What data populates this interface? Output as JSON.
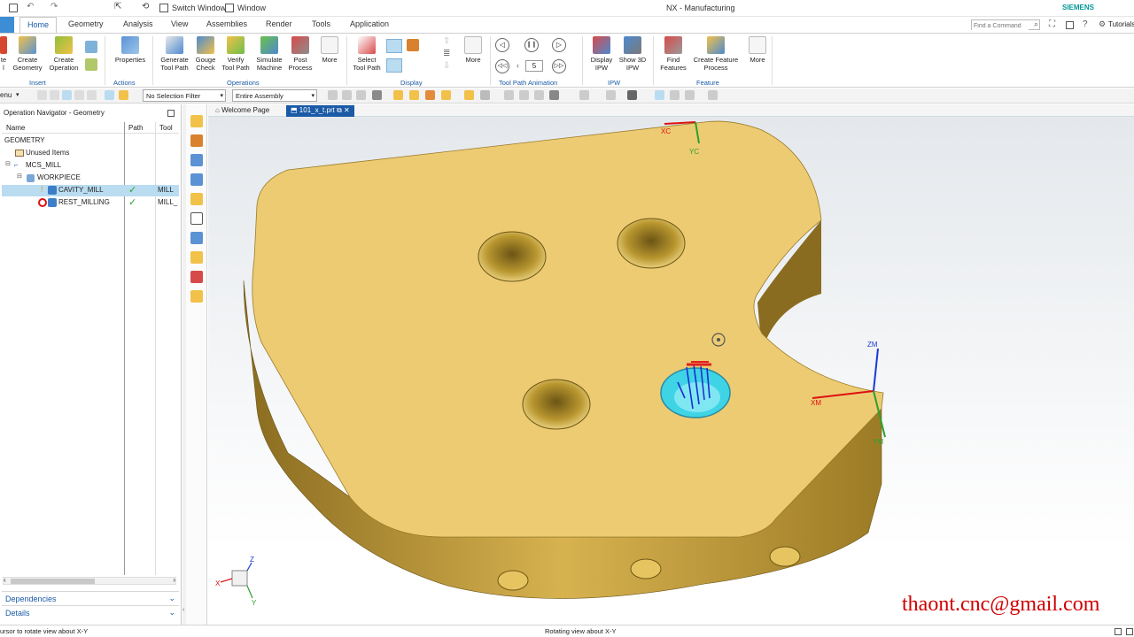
{
  "titlebar": {
    "switch_window": "Switch Window",
    "window": "Window",
    "app_title": "NX - Manufacturing",
    "brand": "SIEMENS",
    "find_command_placeholder": "Find a Command",
    "tutorials": "Tutorials"
  },
  "tabs": [
    "Home",
    "Geometry",
    "Analysis",
    "View",
    "Assemblies",
    "Render",
    "Tools",
    "Application"
  ],
  "ribbon": {
    "insert": {
      "label": "Insert",
      "create_geometry": "Create Geometry",
      "create_operation": "Create Operation",
      "create_program": "te\nl"
    },
    "actions": {
      "label": "Actions",
      "properties": "Properties"
    },
    "operations": {
      "label": "Operations",
      "generate_tool_path": "Generate Tool Path",
      "gouge_check": "Gouge Check",
      "verify_tool_path": "Verify Tool Path",
      "simulate_machine": "Simulate Machine",
      "post_process": "Post Process",
      "more": "More"
    },
    "display": {
      "label": "Display",
      "select_tool_path": "Select Tool Path",
      "more": "More"
    },
    "animation": {
      "label": "Tool Path Animation",
      "speed": "5"
    },
    "ipw": {
      "label": "IPW",
      "display_ipw": "Display IPW",
      "show_3d_ipw": "Show 3D IPW"
    },
    "feature": {
      "label": "Feature",
      "find_features": "Find Features",
      "create_feature_process": "Create Feature Process",
      "more": "More"
    }
  },
  "selbar": {
    "menu": "enu",
    "selection_filter": "No Selection Filter",
    "scope": "Entire Assembly"
  },
  "navigator": {
    "title": "Operation Navigator - Geometry",
    "columns": {
      "name": "Name",
      "path": "Path",
      "tool": "Tool"
    },
    "rows": [
      {
        "name": "GEOMETRY",
        "path": "",
        "tool": ""
      },
      {
        "name": "Unused Items",
        "path": "",
        "tool": ""
      },
      {
        "name": "MCS_MILL",
        "path": "",
        "tool": ""
      },
      {
        "name": "WORKPIECE",
        "path": "",
        "tool": ""
      },
      {
        "name": "CAVITY_MILL",
        "path": "✓",
        "tool": "MILL"
      },
      {
        "name": "REST_MILLING",
        "path": "✓",
        "tool": "MILL_"
      }
    ],
    "dependencies": "Dependencies",
    "details": "Details"
  },
  "doc_tabs": {
    "welcome": "Welcome Page",
    "part": "101_x_t.prt"
  },
  "viewport": {
    "axes": {
      "xc": "XC",
      "yc": "YC",
      "xm": "XM",
      "ym": "YM",
      "zm": "ZM"
    },
    "triad": {
      "x": "X",
      "y": "Y",
      "z": "Z"
    }
  },
  "status": {
    "left": "ursor to rotate view about X-Y",
    "center": "Rotating view about X-Y"
  },
  "watermark": "thaont.cnc@gmail.com",
  "colors": {
    "part": "#edcb73",
    "accent": "#1a5aa6",
    "selected_row": "#b9dcf1",
    "tool_path": "#3fd3e6"
  }
}
